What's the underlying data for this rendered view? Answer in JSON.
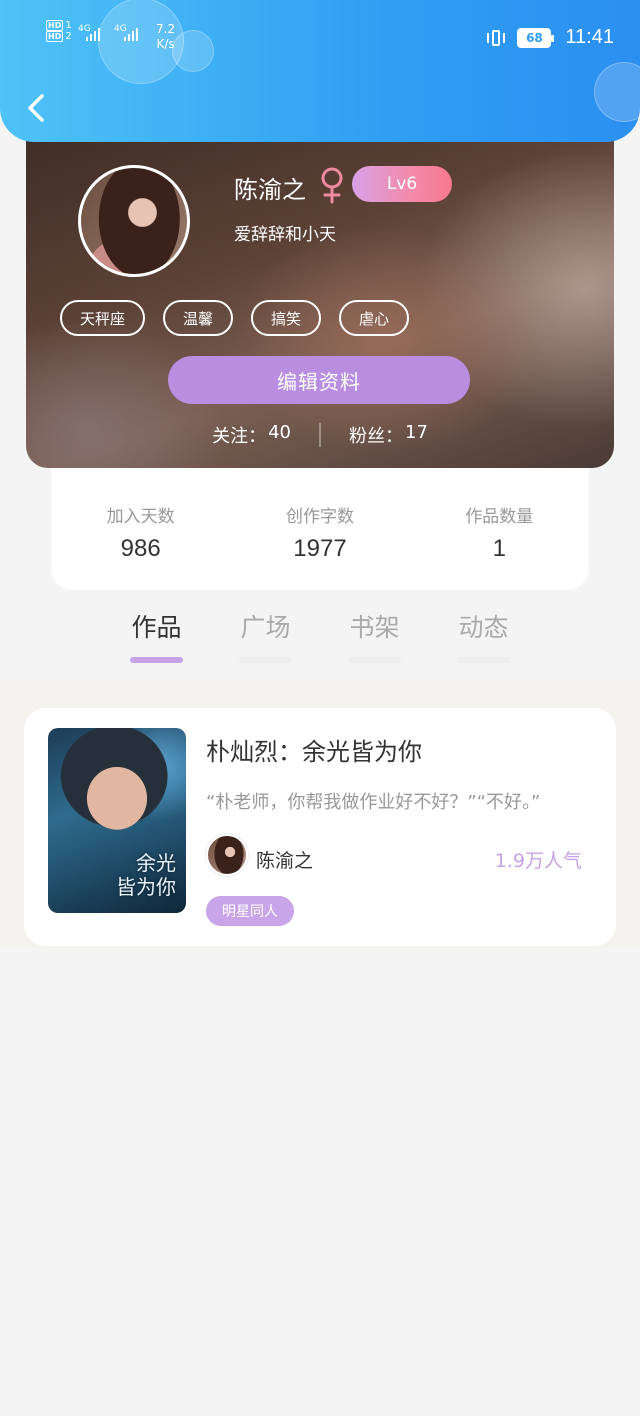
{
  "status_bar": {
    "hd1": "HD",
    "hd1_sub": "1",
    "hd2": "HD",
    "hd2_sub": "2",
    "net1": "4G",
    "net2": "4G",
    "speed_value": "7.2",
    "speed_unit": "K/s",
    "battery": "68",
    "time": "11:41"
  },
  "profile": {
    "username": "陈渝之",
    "gender_icon": "female-icon",
    "level": "Lv6",
    "signature": "爱辞辞和小天",
    "tags": [
      "天秤座",
      "温馨",
      "搞笑",
      "虐心"
    ],
    "edit_button": "编辑资料",
    "following_label": "关注：",
    "following_count": "40",
    "fans_label": "粉丝：",
    "fans_count": "17"
  },
  "stats": [
    {
      "label": "加入天数",
      "value": "986"
    },
    {
      "label": "创作字数",
      "value": "1977"
    },
    {
      "label": "作品数量",
      "value": "1"
    }
  ],
  "tabs": [
    {
      "label": "作品",
      "active": true
    },
    {
      "label": "广场",
      "active": false
    },
    {
      "label": "书架",
      "active": false
    },
    {
      "label": "动态",
      "active": false
    }
  ],
  "works": [
    {
      "title": "朴灿烈：余光皆为你",
      "excerpt": "“朴老师，你帮我做作业好不好？”“不好。”",
      "cover_text_line1": "余光",
      "cover_text_line2": "皆为你",
      "author": "陈渝之",
      "popularity": "1.9万人气",
      "genre": "明星同人"
    }
  ],
  "colors": {
    "header_gradient_start": "#4fc3f7",
    "header_gradient_end": "#2b8ff0",
    "accent_purple": "#b98ee0",
    "level_gradient_end": "#f7788e",
    "female_icon": "#f08aa0"
  }
}
